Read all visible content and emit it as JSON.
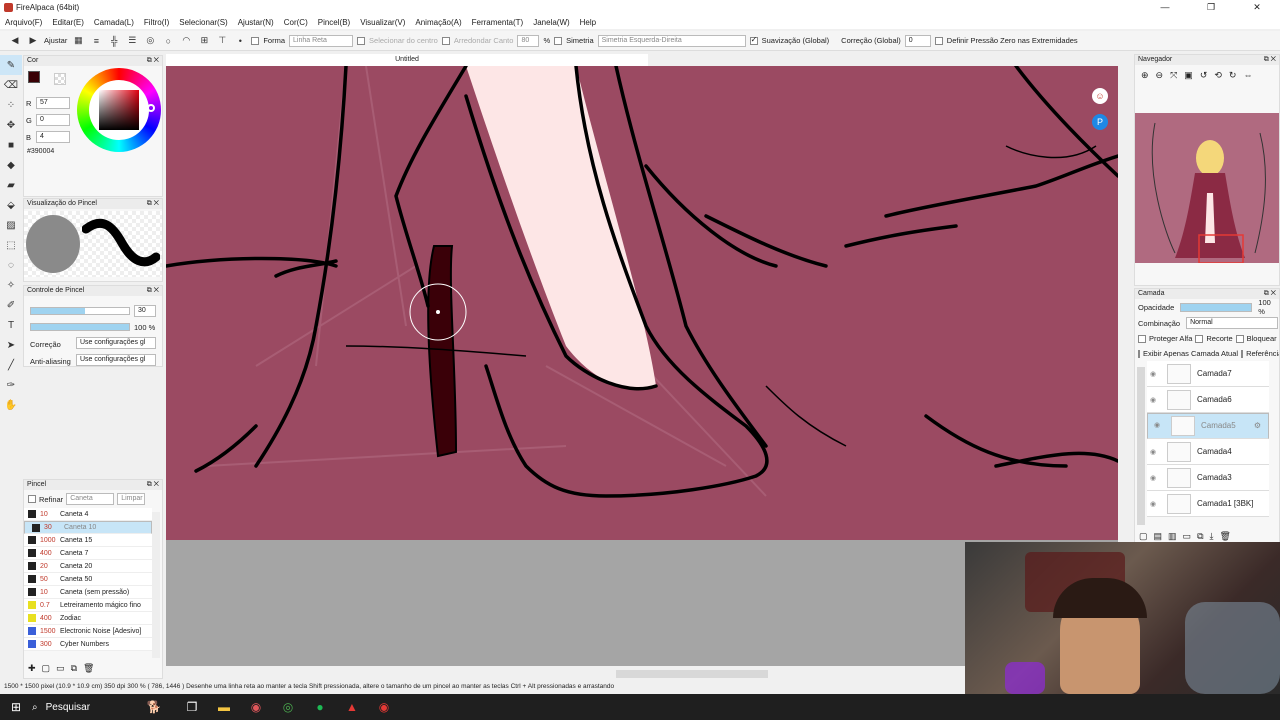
{
  "window": {
    "title": "FireAlpaca (64bit)",
    "controls": [
      "—",
      "❐",
      "✕"
    ]
  },
  "menu": [
    "Arquivo(F)",
    "Editar(E)",
    "Camada(L)",
    "Filtro(I)",
    "Selecionar(S)",
    "Ajustar(N)",
    "Cor(C)",
    "Pincel(B)",
    "Visualizar(V)",
    "Animação(A)",
    "Ferramenta(T)",
    "Janela(W)",
    "Help"
  ],
  "options": {
    "ajustar": "Ajustar",
    "forma": "Forma",
    "linha_reta": "Linha Reta",
    "selecionar_centro": "Selecionar do centro",
    "arredondar_canto": "Arredondar Canto",
    "arredondar_valor": "80",
    "pct": "%",
    "simetria": "Simetria",
    "simetria_tipo": "Simetria Esquerda-Direita",
    "suavizacao": "Suavização (Global)",
    "correcao": "Correção (Global)",
    "correcao_valor": "0",
    "pressao": "Definir Pressão Zero nas Extremidades"
  },
  "color_panel": {
    "title": "Cor",
    "r_label": "R",
    "r": "57",
    "g_label": "G",
    "g": "0",
    "b_label": "B",
    "b": "4",
    "hex": "#390004",
    "current": "#390004"
  },
  "brush_preview": {
    "title": "Visualização do Pincel"
  },
  "brush_control": {
    "title": "Controle de Pincel",
    "size": "30",
    "opacity": "100 %",
    "size_fraction": 0.55,
    "opacity_fraction": 1.0,
    "correcao_label": "Correção",
    "correcao_val": "Use configurações gl",
    "antialias_label": "Anti-aliasing",
    "antialias_val": "Use configurações gl"
  },
  "brush_panel": {
    "title": "Pincel",
    "refinar": "Refinar",
    "search": "Caneta",
    "limpar": "Limpar",
    "brushes": [
      {
        "size": "10",
        "name": "Caneta 4",
        "color": "#222"
      },
      {
        "size": "30",
        "name": "Caneta 10",
        "color": "#222",
        "selected": true
      },
      {
        "size": "1000",
        "name": "Caneta 15",
        "color": "#222"
      },
      {
        "size": "400",
        "name": "Caneta 7",
        "color": "#222"
      },
      {
        "size": "20",
        "name": "Caneta 20",
        "color": "#222"
      },
      {
        "size": "50",
        "name": "Caneta 50",
        "color": "#222"
      },
      {
        "size": "10",
        "name": "Caneta (sem pressão)",
        "color": "#222"
      },
      {
        "size": "0.7",
        "name": "Letreiramento mágico fino",
        "color": "#e8e020"
      },
      {
        "size": "400",
        "name": "Zodiac",
        "color": "#e8e020"
      },
      {
        "size": "1500",
        "name": "Electronic Noise [Adesivo]",
        "color": "#3a5fd9"
      },
      {
        "size": "300",
        "name": "Cyber Numbers",
        "color": "#3a5fd9"
      }
    ]
  },
  "canvas": {
    "tab": "Untitled",
    "bg": "#9b4a62"
  },
  "navigator": {
    "title": "Navegador"
  },
  "layers": {
    "title": "Camada",
    "opacity_label": "Opacidade",
    "opacity": "100 %",
    "blend_label": "Combinação",
    "blend": "Normal",
    "protect_alpha": "Proteger Alfa",
    "clipping": "Recorte",
    "lock": "Bloquear",
    "show_only": "Exibir Apenas Camada Atual",
    "reference": "Referência",
    "items": [
      {
        "name": "Camada7"
      },
      {
        "name": "Camada6"
      },
      {
        "name": "Camada5",
        "selected": true
      },
      {
        "name": "Camada4"
      },
      {
        "name": "Camada3"
      },
      {
        "name": "Camada1 [3BK]"
      }
    ]
  },
  "status": "1500 * 1500 pixel  (10.9 * 10.9 cm)  350 dpi  300 %  ( 786, 1446 )  Desenhe uma linha reta ao manter a tecla Shift pressionada, altere o tamanho de um pincel ao manter as teclas Ctrl + Alt pressionadas e arrastando",
  "taskbar": {
    "search": "Pesquisar"
  }
}
